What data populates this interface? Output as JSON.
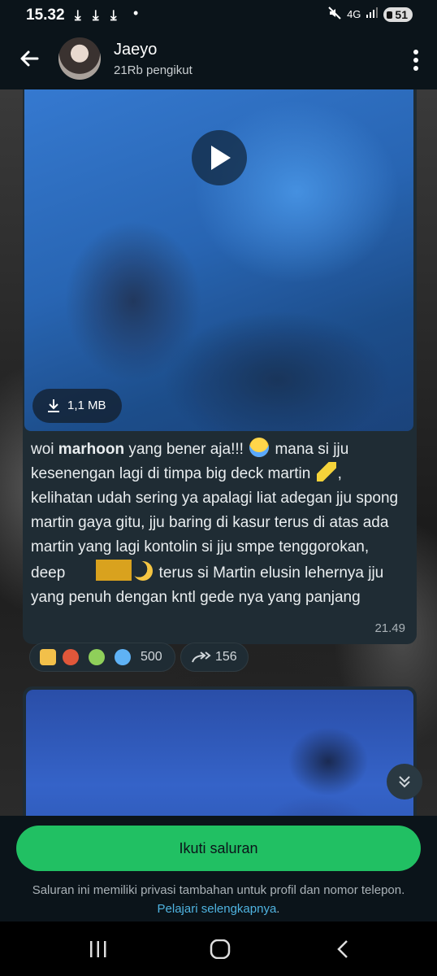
{
  "status_bar": {
    "time": "15.32",
    "downloads": [
      "⤓",
      "⤓",
      "⤓"
    ],
    "dot": "•",
    "network": "4G",
    "battery": "51"
  },
  "header": {
    "title": "Jaeyo",
    "subtitle": "21Rb pengikut",
    "back_icon": "arrow-left-icon",
    "menu_icon": "more-vertical-icon"
  },
  "post": {
    "video": {
      "size": "1,1 MB"
    },
    "text_parts": {
      "p1": "woi ",
      "bold": "marhoon",
      "p2": " yang bener aja!!! ",
      "p3": " mana si jju kesenengan lagi di timpa big deck martin ",
      "p4": ", kelihatan udah sering ya apalagi liat adegan jju spong martin gaya gitu, jju baring di kasur terus di atas ada martin yang lagi kontolin si jju smpe tenggorokan, deep",
      "p5": " terus si Martin elusin lehernya jju yang penuh dengan kntl gede nya yang panjang"
    },
    "time": "21.49",
    "reactions": {
      "count": "500"
    },
    "forwards": {
      "count": "156"
    }
  },
  "bottom": {
    "follow_label": "Ikuti saluran",
    "privacy_text": "Saluran ini memiliki privasi tambahan untuk profil dan nomor telepon. ",
    "privacy_link": "Pelajari selengkapnya",
    "privacy_end": "."
  },
  "colors": {
    "accent": "#21c063",
    "link": "#4fb3e0",
    "bubble": "#1f2c34",
    "header": "#0b141a"
  }
}
